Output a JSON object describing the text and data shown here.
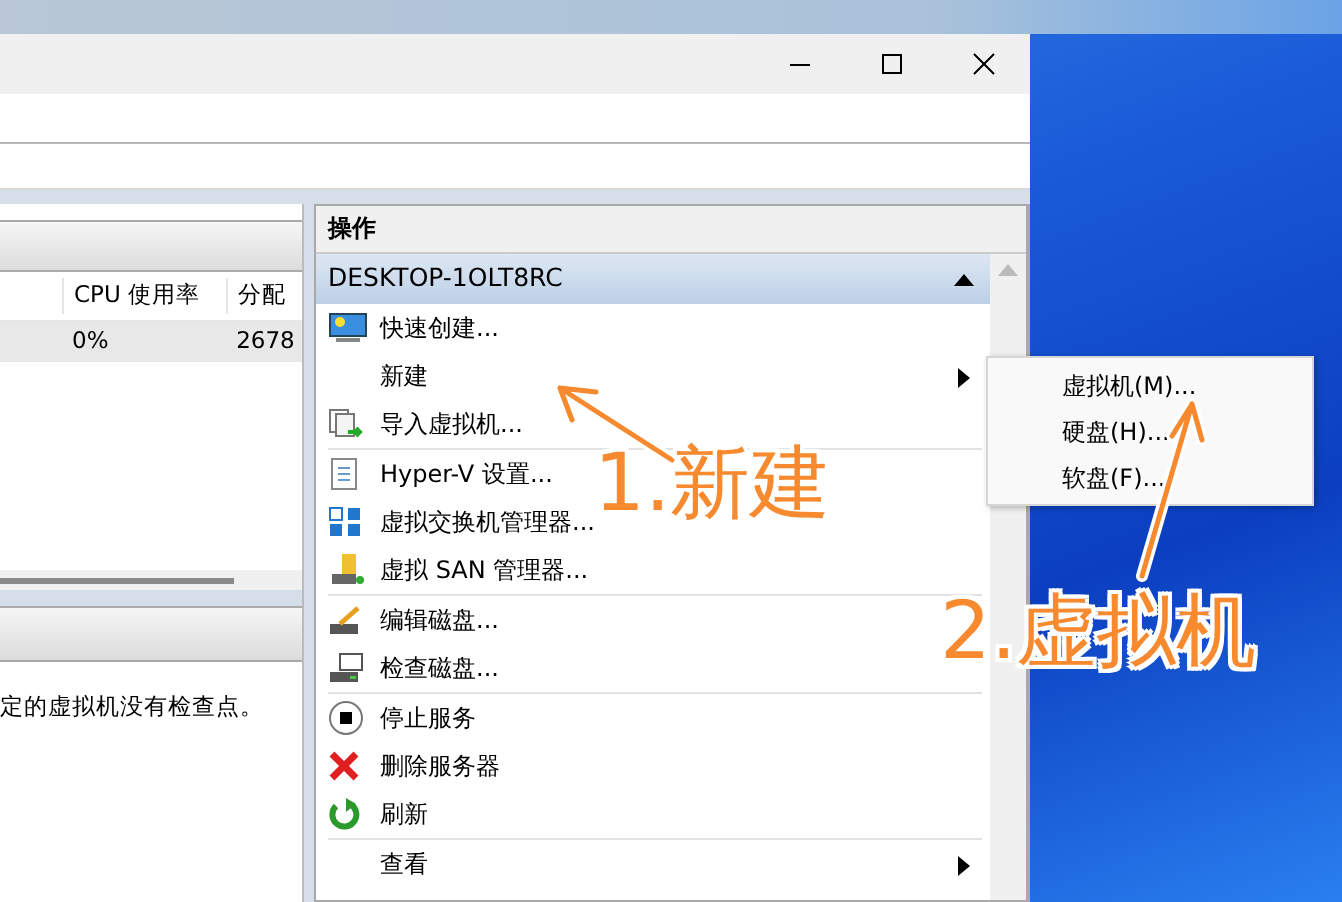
{
  "vm_list": {
    "columns": [
      "CPU 使用率",
      "分配"
    ],
    "rows": [
      [
        "0%",
        "2678"
      ]
    ]
  },
  "checkpoints": {
    "message": "定的虚拟机没有检查点。"
  },
  "actions": {
    "title": "操作",
    "group": {
      "label": "DESKTOP-1OLT8RC",
      "expanded": true
    },
    "sections": [
      [
        {
          "label": "快速创建...",
          "has_submenu": false
        },
        {
          "label": "新建",
          "has_submenu": true
        },
        {
          "label": "导入虚拟机...",
          "has_submenu": false
        }
      ],
      [
        {
          "label": "Hyper-V 设置...",
          "has_submenu": false
        },
        {
          "label": "虚拟交换机管理器...",
          "has_submenu": false
        },
        {
          "label": "虚拟 SAN 管理器...",
          "has_submenu": false
        }
      ],
      [
        {
          "label": "编辑磁盘...",
          "has_submenu": false
        },
        {
          "label": "检查磁盘...",
          "has_submenu": false
        }
      ],
      [
        {
          "label": "停止服务",
          "has_submenu": false
        },
        {
          "label": "删除服务器",
          "has_submenu": false
        },
        {
          "label": "刷新",
          "has_submenu": false
        }
      ],
      [
        {
          "label": "查看",
          "has_submenu": true
        }
      ]
    ]
  },
  "submenu": {
    "items": [
      "虚拟机(M)...",
      "硬盘(H)...",
      "软盘(F)..."
    ]
  },
  "annotations": [
    {
      "text": "1.新建"
    },
    {
      "text": "2.虚拟机"
    }
  ]
}
